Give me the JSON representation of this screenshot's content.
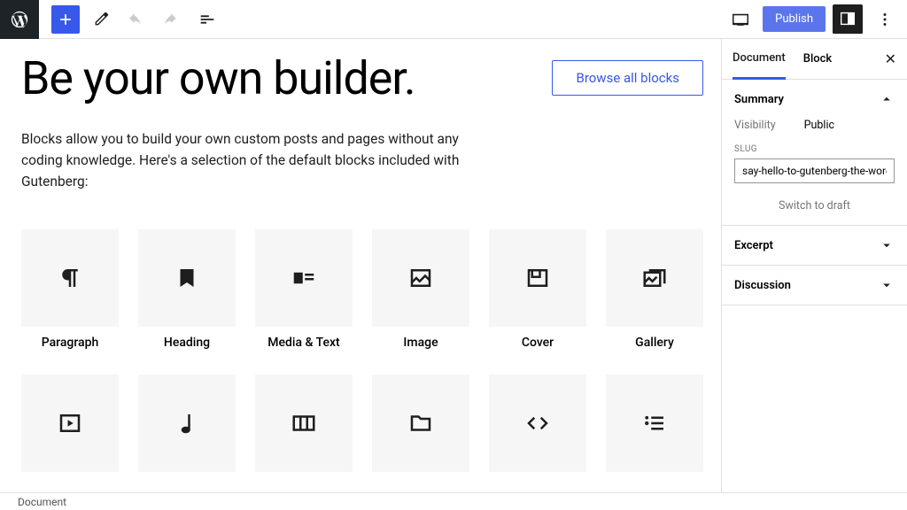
{
  "topbar": {
    "publish": "Publish"
  },
  "hero": {
    "title": "Be your own builder.",
    "browse": "Browse all blocks"
  },
  "intro": "Blocks allow you to build your own custom posts and pages without any coding knowledge. Here's a selection of the default blocks included with Gutenberg:",
  "blocks_row1": [
    {
      "label": "Paragraph"
    },
    {
      "label": "Heading"
    },
    {
      "label": "Media & Text"
    },
    {
      "label": "Image"
    },
    {
      "label": "Cover"
    },
    {
      "label": "Gallery"
    }
  ],
  "sidebar": {
    "tabs": {
      "document": "Document",
      "block": "Block"
    },
    "summary": {
      "title": "Summary",
      "visibility_label": "Visibility",
      "visibility_value": "Public",
      "slug_label": "SLUG",
      "slug_value": "say-hello-to-gutenberg-the-wordpress-ed",
      "switch": "Switch to draft"
    },
    "excerpt": "Excerpt",
    "discussion": "Discussion"
  },
  "footer": "Document"
}
